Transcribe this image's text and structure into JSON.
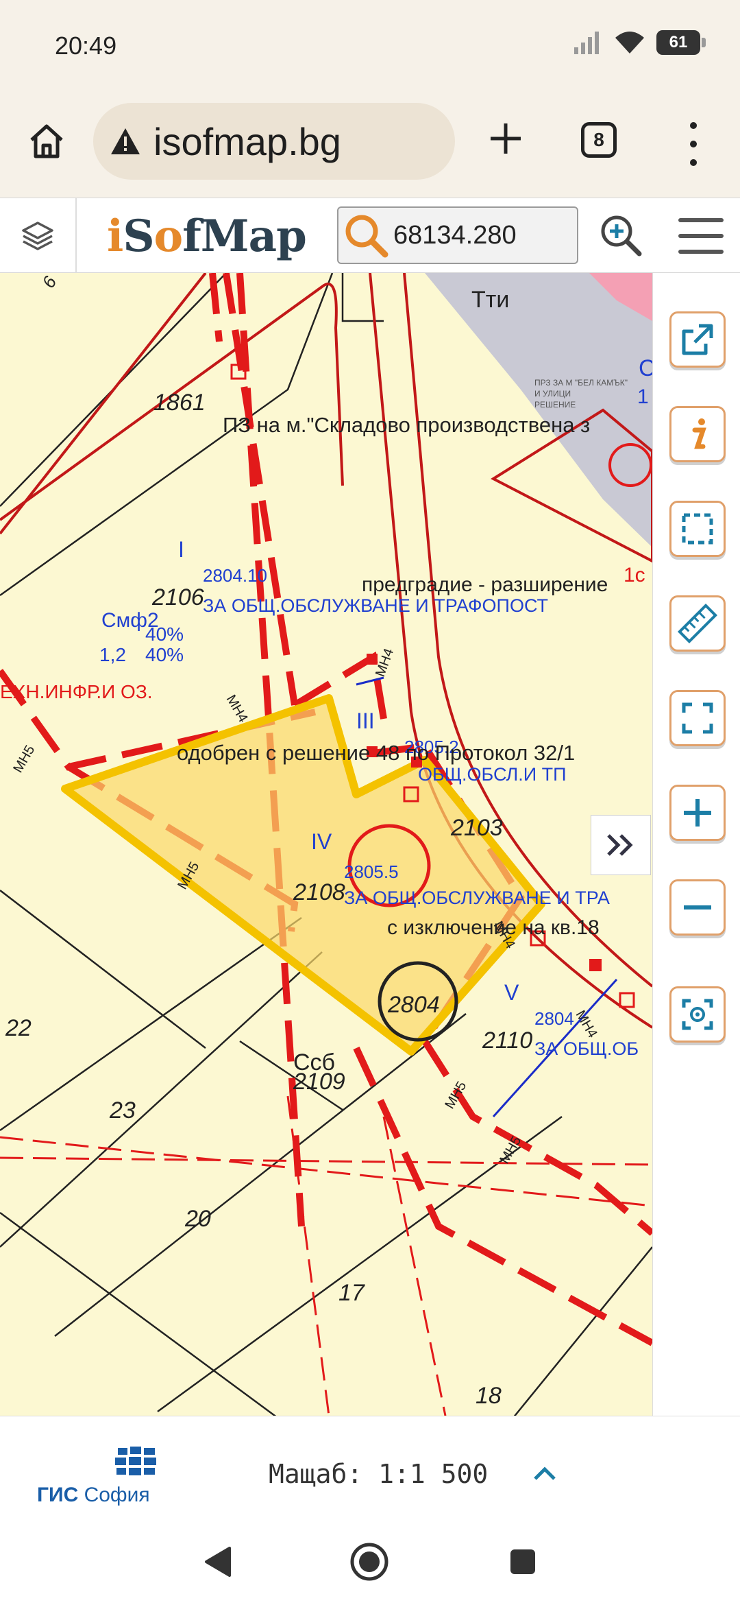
{
  "status_bar": {
    "time": "20:49",
    "battery": "61"
  },
  "browser": {
    "url": "isofmap.bg",
    "tab_count": "8"
  },
  "app": {
    "logo_i": "i",
    "logo_s": "S",
    "logo_o": "o",
    "logo_f": "f",
    "logo_map": "Map",
    "search_value": "68134.280"
  },
  "map": {
    "zone_labels": {
      "tti": "Тти",
      "cm_top": "С",
      "one_top": "1",
      "one_c": "1с",
      "plot_1861": "1861",
      "plan_title": "ПЗ на м.\"Складово производствена з",
      "prz_line1": "ПРЗ ЗА М \"БЕЛ КАМЪК\"",
      "prz_line2": "И УЛИЦИ",
      "prz_line3": "РЕШЕНИЕ",
      "roman_i": "I",
      "code_2804_10": "2804.10",
      "usage_1": "ЗА ОБЩ.ОБСЛУЖВАНЕ И ТРАФОПОСТ",
      "suburb": "предградие - разширение",
      "plot_2106": "2106",
      "smf": "Смф2",
      "pct_40a": "40%",
      "ratio": "1,2",
      "pct_40b": "40%",
      "tech": "ЕХН.ИНФР.И ОЗ.",
      "mn5_a": "МН5",
      "mn4_a": "МН4",
      "mn4_b": "МН4",
      "roman_iii": "III",
      "code_2805_2": "2805.2",
      "approved": "одобрен с решение 48 по Протокол 32/1",
      "usage_tp": "ОБЩ.ОБСЛ.И ТП",
      "mn5_b": "МН5",
      "roman_iv": "IV",
      "plot_2103": "2103",
      "code_2805_5": "2805.5",
      "plot_2108": "2108",
      "usage_2": "ЗА ОБЩ.ОБСЛУЖВАНЕ И ТРА",
      "except": "с изключение на кв.18",
      "mn4_c": "МН4",
      "plot_2804": "2804",
      "roman_v": "V",
      "code_2804_short": "2804",
      "plot_2110": "2110",
      "usage_3": "ЗА ОБЩ.ОБ",
      "mn4_d": "МН4",
      "mn5_c": "МН5",
      "mn5_d": "МН5",
      "plot_22": "22",
      "plot_23": "23",
      "ssb": "Ссб",
      "plot_2109": "2109",
      "plot_20": "20",
      "plot_17": "17",
      "plot_18": "18",
      "plot_6": "6"
    }
  },
  "bottom": {
    "gis_brand": "ГИС",
    "gis_city": "София",
    "scale": "Мащаб: 1:1 500"
  },
  "icons": {
    "home": "home-icon",
    "warning": "warning-icon",
    "layers": "layers-icon",
    "search": "search-icon",
    "zoom_search": "zoom-search-icon",
    "open_external": "open-external-icon",
    "info": "info-icon",
    "select": "select-area-icon",
    "measure": "ruler-icon",
    "fullscreen": "fullscreen-icon",
    "zoom_in": "zoom-in-icon",
    "zoom_out": "zoom-out-icon",
    "locate": "locate-icon"
  },
  "colors": {
    "accent": "#e5892b",
    "brand_dark": "#2d4150",
    "map_bg": "#fcf8d2",
    "plan_red": "#e02020",
    "parcel_yellow": "#f4c200",
    "label_blue": "#2040d0",
    "icon_teal": "#1c7ea6"
  }
}
